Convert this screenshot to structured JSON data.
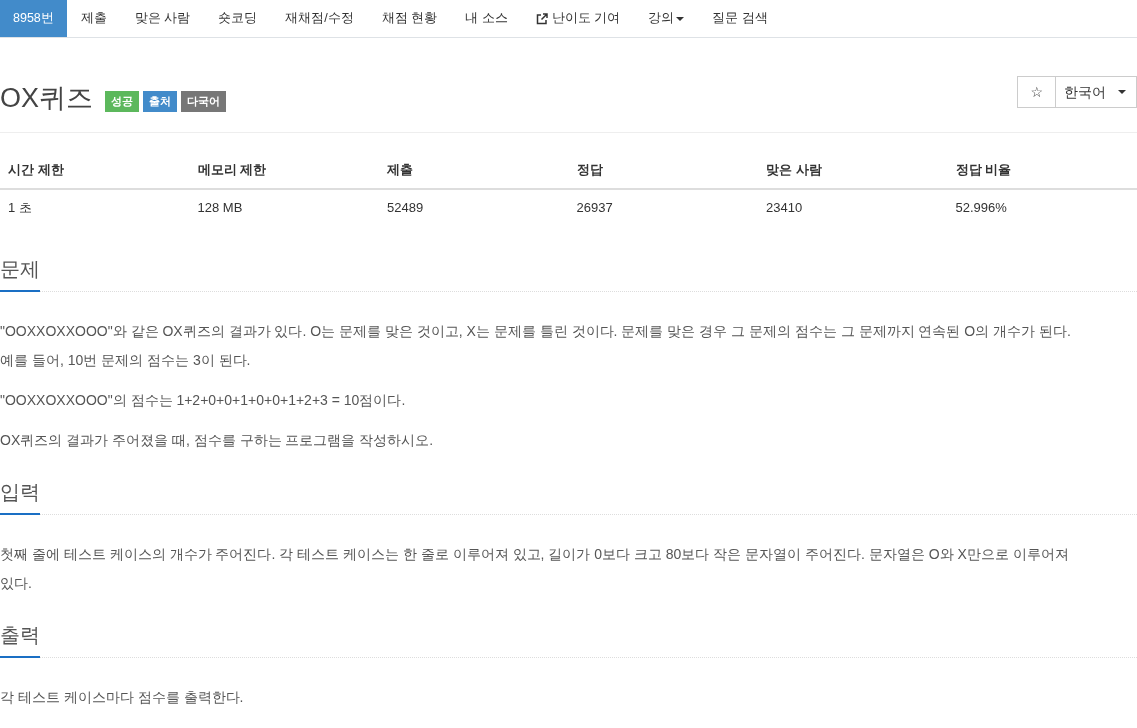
{
  "navbar": {
    "tabs": [
      {
        "label": "8958번",
        "selected": true,
        "kind": "plain"
      },
      {
        "label": "제출",
        "selected": false,
        "kind": "plain"
      },
      {
        "label": "맞은 사람",
        "selected": false,
        "kind": "plain"
      },
      {
        "label": "숏코딩",
        "selected": false,
        "kind": "plain"
      },
      {
        "label": "재채점/수정",
        "selected": false,
        "kind": "plain"
      },
      {
        "label": "채점 현황",
        "selected": false,
        "kind": "plain"
      },
      {
        "label": "내 소스",
        "selected": false,
        "kind": "plain"
      },
      {
        "label": "난이도 기여",
        "selected": false,
        "kind": "external"
      },
      {
        "label": "강의",
        "selected": false,
        "kind": "dropdown"
      },
      {
        "label": "질문 검색",
        "selected": false,
        "kind": "plain"
      }
    ]
  },
  "title": {
    "text": "OX퀴즈",
    "labels": [
      {
        "text": "성공",
        "color": "#5cb85c"
      },
      {
        "text": "출처",
        "color": "#428bca"
      },
      {
        "text": "다국어",
        "color": "#777777"
      }
    ]
  },
  "actions": {
    "star_button": {
      "label": "☆"
    },
    "language_select": {
      "value": "한국어"
    }
  },
  "info_table": {
    "columns": [
      "시간 제한",
      "메모리 제한",
      "제출",
      "정답",
      "맞은 사람",
      "정답 비율"
    ],
    "rows": [
      [
        "1 초",
        "128 MB",
        "52489",
        "26937",
        "23410",
        "52.996%"
      ]
    ]
  },
  "sections": [
    {
      "heading": "문제",
      "paragraphs": [
        "\"OOXXOXXOOO\"와 같은 OX퀴즈의 결과가 있다. O는 문제를 맞은 것이고, X는 문제를 틀린 것이다. 문제를 맞은 경우 그 문제의 점수는 그 문제까지 연속된 O의 개수가 된다. 예를 들어, 10번 문제의 점수는 3이 된다.",
        "\"OOXXOXXOOO\"의 점수는 1+2+0+0+1+0+0+1+2+3 = 10점이다.",
        "OX퀴즈의 결과가 주어졌을 때, 점수를 구하는 프로그램을 작성하시오."
      ]
    },
    {
      "heading": "입력",
      "paragraphs": [
        "첫째 줄에 테스트 케이스의 개수가 주어진다. 각 테스트 케이스는 한 줄로 이루어져 있고, 길이가 0보다 크고 80보다 작은 문자열이 주어진다. 문자열은 O와 X만으로 이루어져 있다."
      ]
    },
    {
      "heading": "출력",
      "paragraphs": [
        "각 테스트 케이스마다 점수를 출력한다."
      ]
    }
  ]
}
